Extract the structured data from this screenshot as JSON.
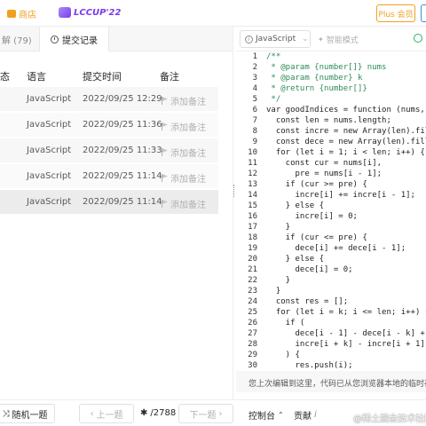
{
  "topbar": {
    "shop_label": "商店",
    "contest_label": "LCCUP'22",
    "plus_label": "Plus 会员"
  },
  "left_tabs": [
    {
      "label": "解 (79)"
    },
    {
      "label": "提交记录"
    }
  ],
  "table": {
    "headers": [
      "态",
      "语言",
      "提交时间",
      "备注"
    ],
    "rows": [
      {
        "language": "JavaScript",
        "time": "2022/09/25 12:29",
        "note": "添加备注"
      },
      {
        "language": "JavaScript",
        "time": "2022/09/25 11:36",
        "note": "添加备注"
      },
      {
        "language": "JavaScript",
        "time": "2022/09/25 11:33",
        "note": "添加备注"
      },
      {
        "language": "JavaScript",
        "time": "2022/09/25 11:14",
        "note": "添加备注"
      },
      {
        "language": "JavaScript",
        "time": "2022/09/25 11:14",
        "note": "添加备注"
      }
    ]
  },
  "editor_toolbar": {
    "language": "JavaScript",
    "smart_mode": "智能模式"
  },
  "code_lines": [
    {
      "n": "1",
      "text": "/**"
    },
    {
      "n": "2",
      "text": " * @param {number[]} nums"
    },
    {
      "n": "3",
      "text": " * @param {number} k"
    },
    {
      "n": "4",
      "text": " * @return {number[]}"
    },
    {
      "n": "5",
      "text": " */"
    },
    {
      "n": "6",
      "text": "var goodIndices = function (nums, k) {"
    },
    {
      "n": "7",
      "text": "  const len = nums.length;"
    },
    {
      "n": "8",
      "text": "  const incre = new Array(len).fill(1);"
    },
    {
      "n": "9",
      "text": "  const dece = new Array(len).fill(1);"
    },
    {
      "n": "10",
      "text": "  for (let i = 1; i < len; i++) {"
    },
    {
      "n": "11",
      "text": "    const cur = nums[i],"
    },
    {
      "n": "12",
      "text": "      pre = nums[i - 1];"
    },
    {
      "n": "13",
      "text": "    if (cur >= pre) {"
    },
    {
      "n": "14",
      "text": "      incre[i] += incre[i - 1];"
    },
    {
      "n": "15",
      "text": "    } else {"
    },
    {
      "n": "16",
      "text": "      incre[i] = 0;"
    },
    {
      "n": "17",
      "text": "    }"
    },
    {
      "n": "18",
      "text": "    if (cur <= pre) {"
    },
    {
      "n": "19",
      "text": "      dece[i] += dece[i - 1];"
    },
    {
      "n": "20",
      "text": "    } else {"
    },
    {
      "n": "21",
      "text": "      dece[i] = 0;"
    },
    {
      "n": "22",
      "text": "    }"
    },
    {
      "n": "23",
      "text": "  }"
    },
    {
      "n": "24",
      "text": "  const res = [];"
    },
    {
      "n": "25",
      "text": "  for (let i = k; i <= len; i++) {"
    },
    {
      "n": "26",
      "text": "    if ("
    },
    {
      "n": "27",
      "text": "      dece[i - 1] - dece[i - k] + 1 =="
    },
    {
      "n": "28",
      "text": "      incre[i + k] - incre[i + 1] + 1"
    },
    {
      "n": "29",
      "text": "    ) {"
    },
    {
      "n": "30",
      "text": "      res.push(i);"
    }
  ],
  "editor_message": "您上次编辑到这里，代码已从您浏览器本地的临时存储中",
  "bottombar": {
    "random_label": "随机一题",
    "prev_label": "上一题",
    "counter": "/2788",
    "next_label": "下一题",
    "console_label": "控制台",
    "contrib_label": "贡献"
  },
  "watermark": "@稀土掘金技术社区"
}
